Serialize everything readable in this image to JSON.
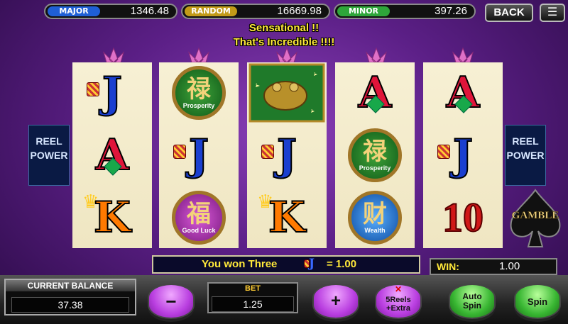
{
  "jackpots": [
    {
      "label": "MAJOR",
      "value": "1346.48",
      "color": "#1f5fd6"
    },
    {
      "label": "RANDOM",
      "value": "16669.98",
      "color": "#c29a18"
    },
    {
      "label": "MINOR",
      "value": "397.26",
      "color": "#2ea63a"
    }
  ],
  "nav": {
    "back_label": "BACK",
    "menu_icon": "hamburger-menu-icon"
  },
  "messages": {
    "line1": "Sensational !!",
    "line2": "That's Incredible !!!!"
  },
  "reels": [
    [
      {
        "type": "J"
      },
      {
        "type": "A"
      },
      {
        "type": "K"
      }
    ],
    [
      {
        "type": "medal",
        "glyph": "禄",
        "caption": "Prosperity"
      },
      {
        "type": "J"
      },
      {
        "type": "medal",
        "glyph": "福",
        "caption": "Good Luck"
      }
    ],
    [
      {
        "type": "frog"
      },
      {
        "type": "J"
      },
      {
        "type": "K"
      }
    ],
    [
      {
        "type": "A"
      },
      {
        "type": "medal",
        "glyph": "禄",
        "caption": "Prosperity"
      },
      {
        "type": "medal",
        "glyph": "财",
        "caption": "Wealth"
      }
    ],
    [
      {
        "type": "A"
      },
      {
        "type": "J"
      },
      {
        "type": "10"
      }
    ]
  ],
  "side_logo": {
    "line1": "REEL",
    "line2": "POWER"
  },
  "gamble_label": "GAMBLE",
  "win_message": {
    "prefix": "You won Three",
    "amount": "= 1.00",
    "symbol": "J"
  },
  "win": {
    "label": "WIN:",
    "value": "1.00"
  },
  "balance": {
    "label": "CURRENT BALANCE",
    "value": "37.38"
  },
  "bet": {
    "label": "BET",
    "value": "1.25"
  },
  "buttons": {
    "minus": "−",
    "plus": "+",
    "reels": "5Reels +Extra",
    "auto": "Auto Spin",
    "spin": "Spin"
  }
}
